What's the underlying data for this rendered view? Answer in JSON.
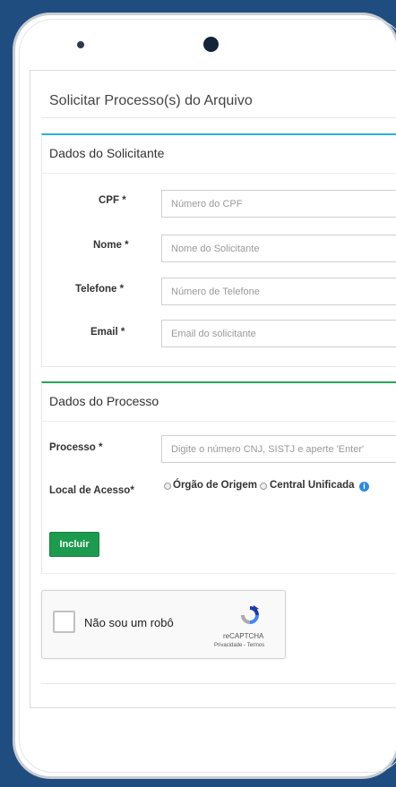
{
  "page": {
    "title": "Solicitar Processo(s) do Arquivo"
  },
  "solicitante": {
    "heading": "Dados do Solicitante",
    "fields": [
      {
        "label": "CPF *",
        "placeholder": "Número do CPF",
        "value": ""
      },
      {
        "label": "Nome *",
        "placeholder": "Nome do Solicitante",
        "value": ""
      },
      {
        "label": "Telefone *",
        "placeholder": "Número de Telefone",
        "value": ""
      },
      {
        "label": "Email *",
        "placeholder": "Email do solicitante",
        "value": ""
      }
    ]
  },
  "processo": {
    "heading": "Dados do Processo",
    "processo_label": "Processo *",
    "processo_placeholder": "Digite o número CNJ, SISTJ e aperte 'Enter'",
    "local_label": "Local de Acesso*",
    "options": [
      "Órgão de Origem",
      "Central Unificada"
    ],
    "info_icon": "info-circle-icon",
    "button_label": "Incluir"
  },
  "captcha": {
    "label": "Não sou um robô",
    "brand": "reCAPTCHA",
    "links": "Privacidade - Termos",
    "icon": "recaptcha-logo-icon"
  },
  "colors": {
    "background": "#1f4d80",
    "solicitante_accent": "#2db1d8",
    "processo_accent": "#26a35a",
    "button": "#1c9b4e",
    "info": "#2a8be0"
  }
}
